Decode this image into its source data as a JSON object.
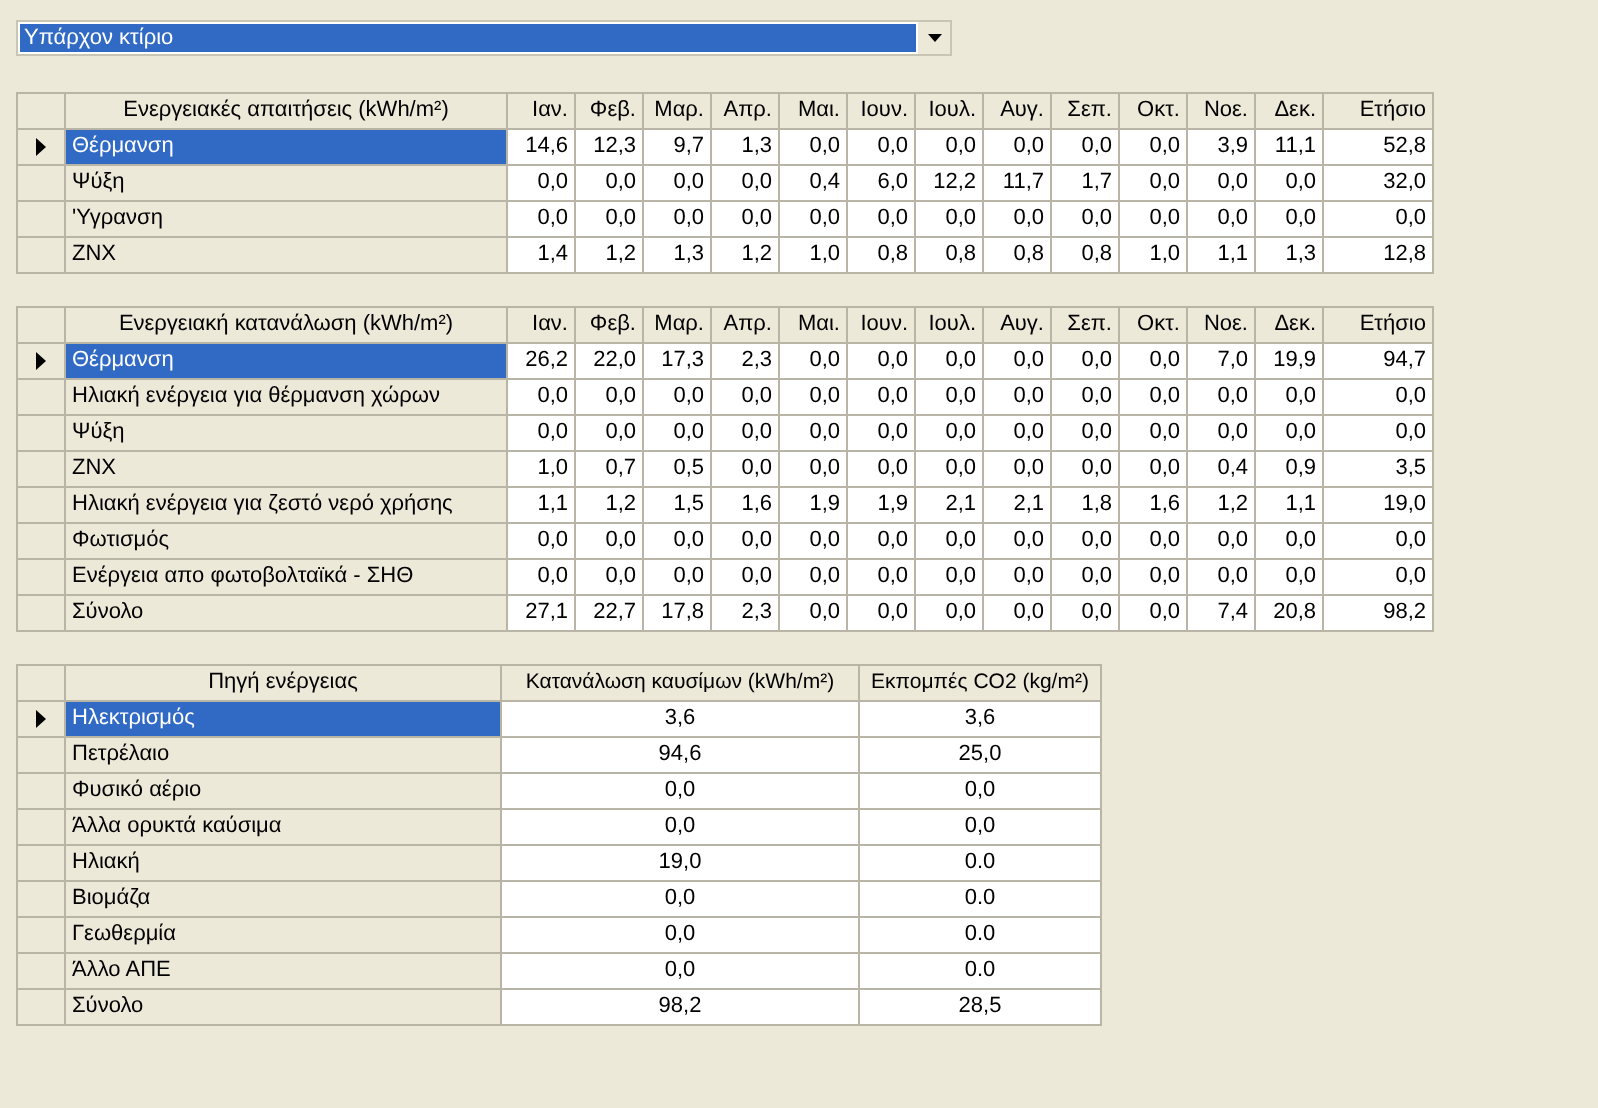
{
  "dropdown": {
    "value": "Υπάρχον κτίριο"
  },
  "tables": [
    {
      "kind": "monthly",
      "columns": [
        "Ενεργειακές απαιτήσεις (kWh/m²)",
        "Ιαν.",
        "Φεβ.",
        "Μαρ.",
        "Απρ.",
        "Μαι.",
        "Ιουν.",
        "Ιουλ.",
        "Αυγ.",
        "Σεπ.",
        "Οκτ.",
        "Νοε.",
        "Δεκ.",
        "Ετήσιο"
      ],
      "rows": [
        {
          "name": "Θέρμανση",
          "selected": true,
          "values": [
            "14,6",
            "12,3",
            "9,7",
            "1,3",
            "0,0",
            "0,0",
            "0,0",
            "0,0",
            "0,0",
            "0,0",
            "3,9",
            "11,1",
            "52,8"
          ]
        },
        {
          "name": "Ψύξη",
          "selected": false,
          "values": [
            "0,0",
            "0,0",
            "0,0",
            "0,0",
            "0,4",
            "6,0",
            "12,2",
            "11,7",
            "1,7",
            "0,0",
            "0,0",
            "0,0",
            "32,0"
          ]
        },
        {
          "name": "'Υγρανση",
          "selected": false,
          "values": [
            "0,0",
            "0,0",
            "0,0",
            "0,0",
            "0,0",
            "0,0",
            "0,0",
            "0,0",
            "0,0",
            "0,0",
            "0,0",
            "0,0",
            "0,0"
          ]
        },
        {
          "name": "ΖΝΧ",
          "selected": false,
          "values": [
            "1,4",
            "1,2",
            "1,3",
            "1,2",
            "1,0",
            "0,8",
            "0,8",
            "0,8",
            "0,8",
            "1,0",
            "1,1",
            "1,3",
            "12,8"
          ]
        }
      ]
    },
    {
      "kind": "monthly",
      "columns": [
        "Ενεργειακή κατανάλωση (kWh/m²)",
        "Ιαν.",
        "Φεβ.",
        "Μαρ.",
        "Απρ.",
        "Μαι.",
        "Ιουν.",
        "Ιουλ.",
        "Αυγ.",
        "Σεπ.",
        "Οκτ.",
        "Νοε.",
        "Δεκ.",
        "Ετήσιο"
      ],
      "rows": [
        {
          "name": "Θέρμανση",
          "selected": true,
          "values": [
            "26,2",
            "22,0",
            "17,3",
            "2,3",
            "0,0",
            "0,0",
            "0,0",
            "0,0",
            "0,0",
            "0,0",
            "7,0",
            "19,9",
            "94,7"
          ]
        },
        {
          "name": "Ηλιακή ενέργεια για θέρμανση χώρων",
          "selected": false,
          "values": [
            "0,0",
            "0,0",
            "0,0",
            "0,0",
            "0,0",
            "0,0",
            "0,0",
            "0,0",
            "0,0",
            "0,0",
            "0,0",
            "0,0",
            "0,0"
          ]
        },
        {
          "name": "Ψύξη",
          "selected": false,
          "values": [
            "0,0",
            "0,0",
            "0,0",
            "0,0",
            "0,0",
            "0,0",
            "0,0",
            "0,0",
            "0,0",
            "0,0",
            "0,0",
            "0,0",
            "0,0"
          ]
        },
        {
          "name": "ΖΝΧ",
          "selected": false,
          "values": [
            "1,0",
            "0,7",
            "0,5",
            "0,0",
            "0,0",
            "0,0",
            "0,0",
            "0,0",
            "0,0",
            "0,0",
            "0,4",
            "0,9",
            "3,5"
          ]
        },
        {
          "name": "Ηλιακή ενέργεια για ζεστό νερό χρήσης",
          "selected": false,
          "values": [
            "1,1",
            "1,2",
            "1,5",
            "1,6",
            "1,9",
            "1,9",
            "2,1",
            "2,1",
            "1,8",
            "1,6",
            "1,2",
            "1,1",
            "19,0"
          ]
        },
        {
          "name": "Φωτισμός",
          "selected": false,
          "values": [
            "0,0",
            "0,0",
            "0,0",
            "0,0",
            "0,0",
            "0,0",
            "0,0",
            "0,0",
            "0,0",
            "0,0",
            "0,0",
            "0,0",
            "0,0"
          ]
        },
        {
          "name": "Ενέργεια απο φωτοβολταϊκά - ΣΗΘ",
          "selected": false,
          "values": [
            "0,0",
            "0,0",
            "0,0",
            "0,0",
            "0,0",
            "0,0",
            "0,0",
            "0,0",
            "0,0",
            "0,0",
            "0,0",
            "0,0",
            "0,0"
          ]
        },
        {
          "name": "Σύνολο",
          "selected": false,
          "values": [
            "27,1",
            "22,7",
            "17,8",
            "2,3",
            "0,0",
            "0,0",
            "0,0",
            "0,0",
            "0,0",
            "0,0",
            "7,4",
            "20,8",
            "98,2"
          ]
        }
      ]
    },
    {
      "kind": "sources",
      "columns": [
        "Πηγή ενέργειας",
        "Κατανάλωση καυσίμων (kWh/m²)",
        "Εκπομπές CO2 (kg/m²)"
      ],
      "rows": [
        {
          "name": "Ηλεκτρισμός",
          "selected": true,
          "values": [
            "3,6",
            "3,6"
          ]
        },
        {
          "name": "Πετρέλαιο",
          "selected": false,
          "values": [
            "94,6",
            "25,0"
          ]
        },
        {
          "name": "Φυσικό αέριο",
          "selected": false,
          "values": [
            "0,0",
            "0,0"
          ]
        },
        {
          "name": "Άλλα ορυκτά καύσιμα",
          "selected": false,
          "values": [
            "0,0",
            "0,0"
          ]
        },
        {
          "name": "Ηλιακή",
          "selected": false,
          "values": [
            "19,0",
            "0.0"
          ]
        },
        {
          "name": "Βιομάζα",
          "selected": false,
          "values": [
            "0,0",
            "0.0"
          ]
        },
        {
          "name": "Γεωθερμία",
          "selected": false,
          "values": [
            "0,0",
            "0.0"
          ]
        },
        {
          "name": "Άλλο ΑΠΕ",
          "selected": false,
          "values": [
            "0,0",
            "0.0"
          ]
        },
        {
          "name": "Σύνολο",
          "selected": false,
          "values": [
            "98,2",
            "28,5"
          ]
        }
      ]
    }
  ]
}
